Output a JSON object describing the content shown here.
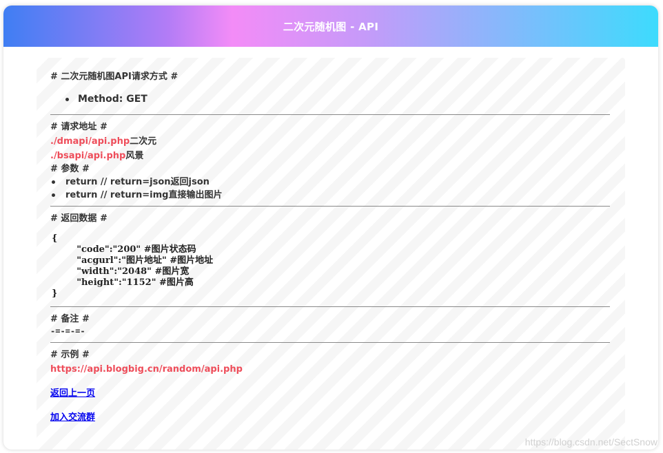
{
  "header": {
    "title": "二次元随机图 - API"
  },
  "sections": {
    "method": {
      "title": "# 二次元随机图API请求方式 #",
      "item": "Method: GET"
    },
    "address": {
      "title": "# 请求地址 #",
      "links": [
        {
          "url": "./dmapi/api.php",
          "desc": "二次元"
        },
        {
          "url": "./bsapi/api.php",
          "desc": "风景"
        }
      ]
    },
    "params": {
      "title": "# 参数 #",
      "items": [
        "return // return=json返回json",
        "return // return=img直接输出图片"
      ]
    },
    "response": {
      "title": "# 返回数据 #",
      "code": "{\n        \"code\":\"200\" #图片状态码\n        \"acgurl\":\"图片地址\" #图片地址\n        \"width\":\"2048\" #图片宽\n        \"height\":\"1152\" #图片高\n}"
    },
    "notes": {
      "title": "# 备注 #",
      "text": "-=-=-=-"
    },
    "example": {
      "title": "# 示例 #",
      "url": "https://api.blogbig.cn/random/api.php"
    }
  },
  "links": {
    "back": "返回上一页",
    "join": "加入交流群"
  },
  "watermark": "https://blog.csdn.net/SectSnow",
  "colors": {
    "link_red": "#ee4d5a",
    "nav_link": "#0000ee"
  }
}
